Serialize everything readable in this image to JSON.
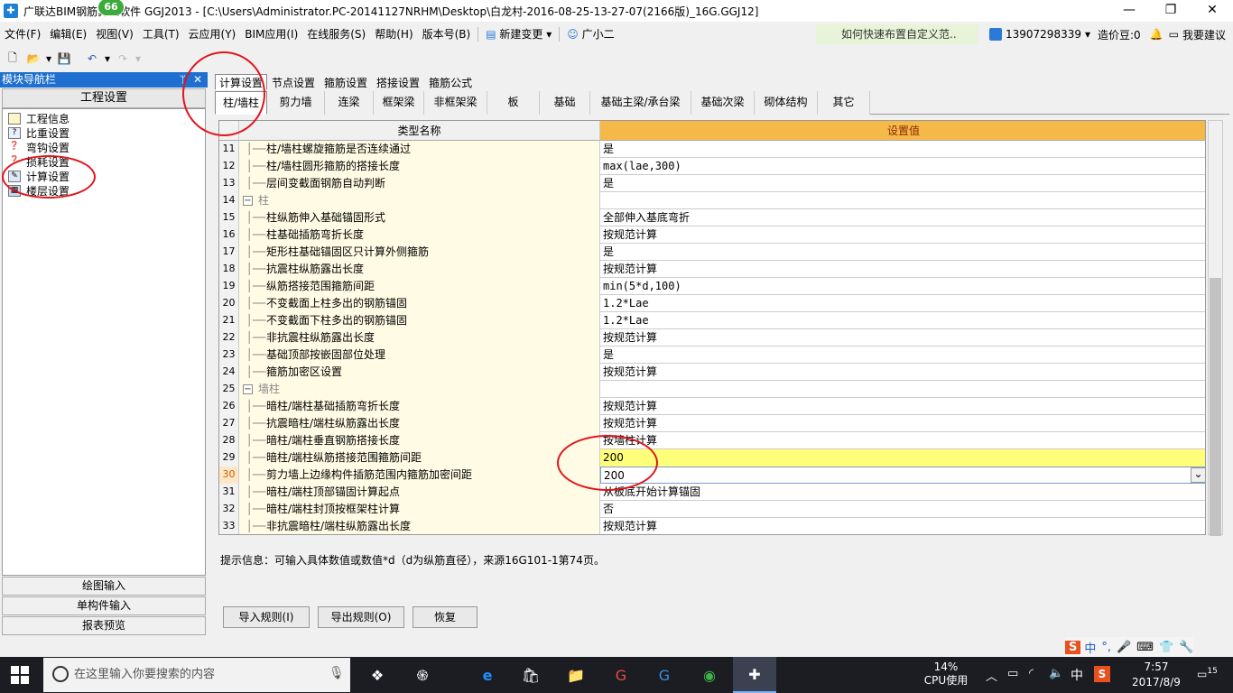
{
  "window": {
    "title": "广联达BIM钢筋算量软件 GGJ2013 - [C:\\Users\\Administrator.PC-20141127NRHM\\Desktop\\白龙村-2016-08-25-13-27-07(2166版)_16G.GGJ12]",
    "badge": "66",
    "minimize": "—",
    "restore": "❐",
    "close": "✕"
  },
  "menu": {
    "items": [
      "文件(F)",
      "编辑(E)",
      "视图(V)",
      "工具(T)",
      "云应用(Y)",
      "BIM应用(I)",
      "在线服务(S)",
      "帮助(H)",
      "版本号(B)"
    ],
    "new_change": "新建变更",
    "assistant": "广小二",
    "promo": "如何快速布置自定义范..",
    "phone": "13907298339",
    "coins": "造价豆:0",
    "suggest": "我要建议"
  },
  "nav": {
    "header": "模块导航栏",
    "pin": "ᛘ",
    "close": "✕",
    "section": "工程设置",
    "items": [
      "工程信息",
      "比重设置",
      "弯钩设置",
      "损耗设置",
      "计算设置",
      "楼层设置"
    ],
    "buttons": [
      "绘图输入",
      "单构件输入",
      "报表预览"
    ]
  },
  "tabs": {
    "top": [
      "计算设置",
      "节点设置",
      "箍筋设置",
      "搭接设置",
      "箍筋公式"
    ],
    "sub": [
      "柱/墙柱",
      "剪力墙",
      "连梁",
      "框架梁",
      "非框架梁",
      "板",
      "基础",
      "基础主梁/承台梁",
      "基础次梁",
      "砌体结构",
      "其它"
    ]
  },
  "grid": {
    "col_name": "类型名称",
    "col_value": "设置值",
    "rows": [
      {
        "no": "11",
        "name": "柱/墙柱螺旋箍筋是否连续通过",
        "value": "是"
      },
      {
        "no": "12",
        "name": "柱/墙柱圆形箍筋的搭接长度",
        "value": "max(lae,300)"
      },
      {
        "no": "13",
        "name": "层间变截面钢筋自动判断",
        "value": "是"
      },
      {
        "no": "14",
        "name": "柱",
        "value": "",
        "group": true
      },
      {
        "no": "15",
        "name": "柱纵筋伸入基础锚固形式",
        "value": "全部伸入基底弯折"
      },
      {
        "no": "16",
        "name": "柱基础插筋弯折长度",
        "value": "按规范计算"
      },
      {
        "no": "17",
        "name": "矩形柱基础锚固区只计算外侧箍筋",
        "value": "是"
      },
      {
        "no": "18",
        "name": "抗震柱纵筋露出长度",
        "value": "按规范计算"
      },
      {
        "no": "19",
        "name": "纵筋搭接范围箍筋间距",
        "value": "min(5*d,100)"
      },
      {
        "no": "20",
        "name": "不变截面上柱多出的钢筋锚固",
        "value": "1.2*Lae"
      },
      {
        "no": "21",
        "name": "不变截面下柱多出的钢筋锚固",
        "value": "1.2*Lae"
      },
      {
        "no": "22",
        "name": "非抗震柱纵筋露出长度",
        "value": "按规范计算"
      },
      {
        "no": "23",
        "name": "基础顶部按嵌固部位处理",
        "value": "是"
      },
      {
        "no": "24",
        "name": "箍筋加密区设置",
        "value": "按规范计算"
      },
      {
        "no": "25",
        "name": "墙柱",
        "value": "",
        "group": true
      },
      {
        "no": "26",
        "name": "暗柱/端柱基础插筋弯折长度",
        "value": "按规范计算"
      },
      {
        "no": "27",
        "name": "抗震暗柱/端柱纵筋露出长度",
        "value": "按规范计算"
      },
      {
        "no": "28",
        "name": "暗柱/端柱垂直钢筋搭接长度",
        "value": "按墙柱计算"
      },
      {
        "no": "29",
        "name": "暗柱/端柱纵筋搭接范围箍筋间距",
        "value": "200",
        "highlight": true
      },
      {
        "no": "30",
        "name": "剪力墙上边缘构件插筋范围内箍筋加密间距",
        "value": "200",
        "editing": true
      },
      {
        "no": "31",
        "name": "暗柱/端柱顶部锚固计算起点",
        "value": "从板底开始计算锚固"
      },
      {
        "no": "32",
        "name": "暗柱/端柱封顶按框架柱计算",
        "value": "否"
      },
      {
        "no": "33",
        "name": "非抗震暗柱/端柱纵筋露出长度",
        "value": "按规范计算"
      }
    ]
  },
  "hint": "提示信息：可输入具体数值或数值*d（d为纵筋直径），来源16G101-1第74页。",
  "buttons": {
    "import": "导入规则(I)",
    "export": "导出规则(O)",
    "restore": "恢复"
  },
  "taskbar": {
    "search_placeholder": "在这里输入你要搜索的内容",
    "cpu": "14%",
    "cpu_label": "CPU使用",
    "ime": "中",
    "time": "7:57",
    "date": "2017/8/9",
    "notif": "15"
  },
  "ime_bar": {
    "items": [
      "S",
      "中",
      "°,",
      "🎤",
      "⌨",
      "👕",
      "🔧"
    ]
  },
  "colors": {
    "header_value_bg": "#f5b94a",
    "name_col_bg": "#fffbe4",
    "highlight_row": "#ffff7a",
    "annotation": "#e0141c"
  }
}
